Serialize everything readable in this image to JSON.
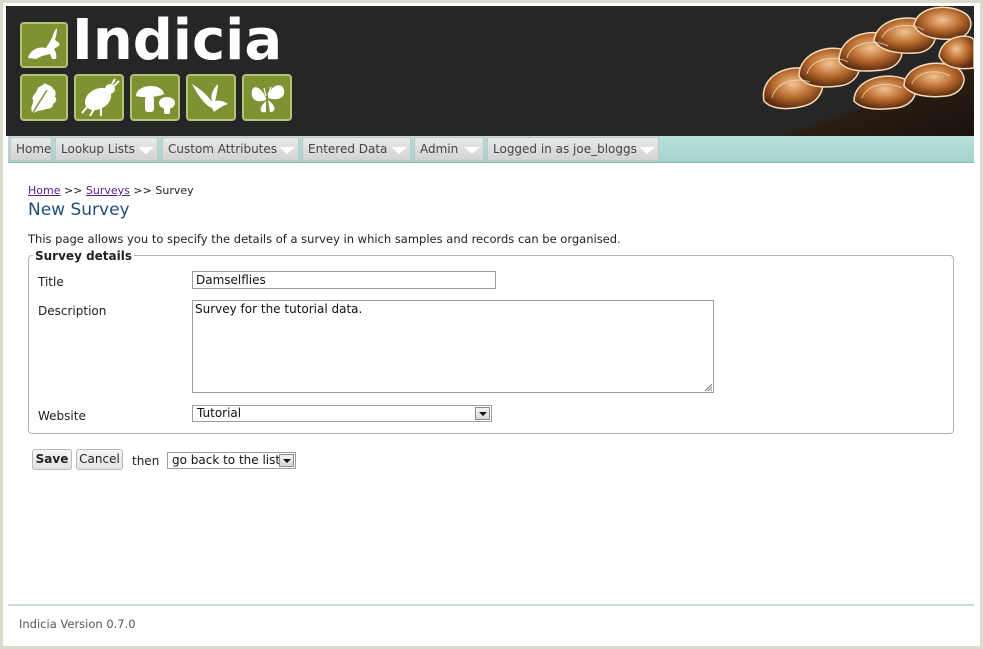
{
  "header": {
    "logo_text": "Indicia",
    "logo_icons": [
      "hare-icon",
      "oak-leaf-icon",
      "beetle-icon",
      "mushroom-icon",
      "swallow-icon",
      "butterfly-icon"
    ]
  },
  "nav": {
    "items": [
      {
        "label": "Home",
        "has_dropdown": false
      },
      {
        "label": "Lookup Lists",
        "has_dropdown": true
      },
      {
        "label": "Custom Attributes",
        "has_dropdown": true
      },
      {
        "label": "Entered Data",
        "has_dropdown": true
      },
      {
        "label": "Admin",
        "has_dropdown": true
      },
      {
        "label": "Logged in as joe_bloggs",
        "has_dropdown": true
      }
    ]
  },
  "breadcrumb": {
    "home": "Home",
    "sep1": ">>",
    "surveys": "Surveys",
    "sep2": ">>",
    "current": "Survey"
  },
  "page": {
    "title": "New Survey",
    "intro": "This page allows you to specify the details of a survey in which samples and records can be organised."
  },
  "form": {
    "legend": "Survey details",
    "title_label": "Title",
    "title_value": "Damselflies",
    "description_label": "Description",
    "description_value": "Survey for the tutorial data.",
    "website_label": "Website",
    "website_value": "Tutorial"
  },
  "actions": {
    "save": "Save",
    "cancel": "Cancel",
    "then": "then",
    "after_save_value": "go back to the list"
  },
  "footer": {
    "version": "Indicia Version 0.7.0"
  },
  "colors": {
    "banner_bg": "#262626",
    "logo_green": "#7d9233",
    "nav_bg": "#a4d3cc",
    "title_blue": "#1f4e79",
    "link_purple": "#551a8b"
  }
}
